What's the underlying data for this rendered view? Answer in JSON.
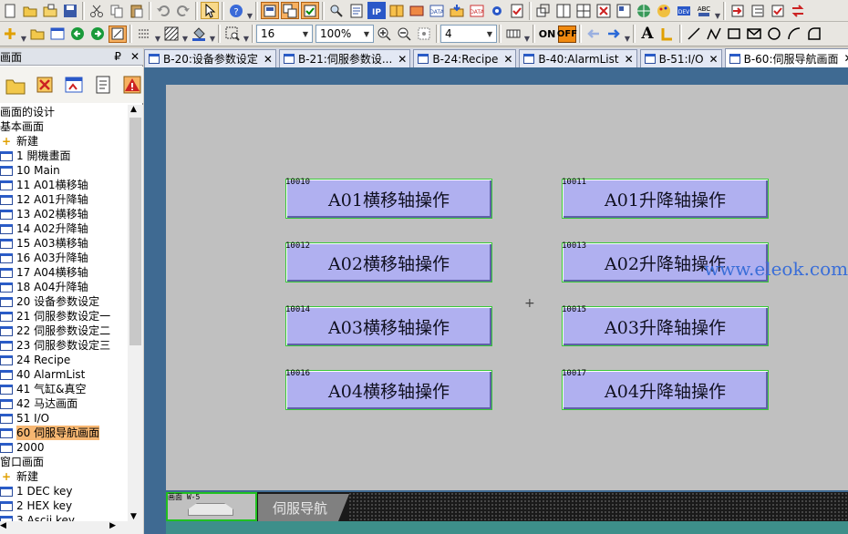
{
  "toolbar": {
    "font_size": "16",
    "zoom": "100%",
    "line_width": "4",
    "on_label": "ON",
    "off_label": "OFF",
    "text_tool": "A"
  },
  "left_panel": {
    "title": "画面",
    "pin": "₽",
    "close": "✕",
    "tree": [
      {
        "label": "画面的设计",
        "type": "header"
      },
      {
        "label": "基本画面",
        "type": "header"
      },
      {
        "label": "新建",
        "type": "new"
      },
      {
        "label": "1 開機畫面",
        "type": "screen"
      },
      {
        "label": "10 Main",
        "type": "screen"
      },
      {
        "label": "11 A01横移轴",
        "type": "screen"
      },
      {
        "label": "12 A01升降轴",
        "type": "screen"
      },
      {
        "label": "13 A02横移轴",
        "type": "screen"
      },
      {
        "label": "14 A02升降轴",
        "type": "screen"
      },
      {
        "label": "15 A03横移轴",
        "type": "screen"
      },
      {
        "label": "16 A03升降轴",
        "type": "screen"
      },
      {
        "label": "17 A04横移轴",
        "type": "screen"
      },
      {
        "label": "18 A04升降轴",
        "type": "screen"
      },
      {
        "label": "20 设备参数设定",
        "type": "screen"
      },
      {
        "label": "21 伺服参数设定一",
        "type": "screen"
      },
      {
        "label": "22 伺服参数设定二",
        "type": "screen"
      },
      {
        "label": "23 伺服参数设定三",
        "type": "screen"
      },
      {
        "label": "24 Recipe",
        "type": "screen"
      },
      {
        "label": "40 AlarmList",
        "type": "screen"
      },
      {
        "label": "41 气缸&真空",
        "type": "screen"
      },
      {
        "label": "42 马达画面",
        "type": "screen"
      },
      {
        "label": "51 I/O",
        "type": "screen"
      },
      {
        "label": "60 伺服导航画面",
        "type": "screen",
        "selected": true
      },
      {
        "label": "2000",
        "type": "screen"
      },
      {
        "label": "窗口画面",
        "type": "header"
      },
      {
        "label": "新建",
        "type": "new"
      },
      {
        "label": "1 DEC key",
        "type": "screen"
      },
      {
        "label": "2 HEX key",
        "type": "screen"
      },
      {
        "label": "3 Ascii key",
        "type": "screen"
      }
    ]
  },
  "tabs": [
    {
      "label": "B-20:设备参数设定",
      "active": false
    },
    {
      "label": "B-21:伺服参数设...",
      "active": false
    },
    {
      "label": "B-24:Recipe",
      "active": false
    },
    {
      "label": "B-40:AlarmList",
      "active": false
    },
    {
      "label": "B-51:I/O",
      "active": false
    },
    {
      "label": "B-60:伺服导航画面",
      "active": true
    }
  ],
  "buttons": [
    {
      "addr": "10010",
      "label": "A01横移轴操作"
    },
    {
      "addr": "10011",
      "label": "A01升降轴操作"
    },
    {
      "addr": "10012",
      "label": "A02横移轴操作"
    },
    {
      "addr": "10013",
      "label": "A02升降轴操作"
    },
    {
      "addr": "10014",
      "label": "A03横移轴操作"
    },
    {
      "addr": "10015",
      "label": "A03升降轴操作"
    },
    {
      "addr": "10016",
      "label": "A04横移轴操作"
    },
    {
      "addr": "10017",
      "label": "A04升降轴操作"
    }
  ],
  "bottom": {
    "thumb_label": "画面 W-5",
    "sheet_tab": "伺服导航"
  },
  "watermark": "www.eleok.com",
  "colors": {
    "button_fill": "#b0b0f0",
    "selected_row": "#f7b772",
    "canvas": "#c0c0c0",
    "workarea": "#3f6a92"
  }
}
